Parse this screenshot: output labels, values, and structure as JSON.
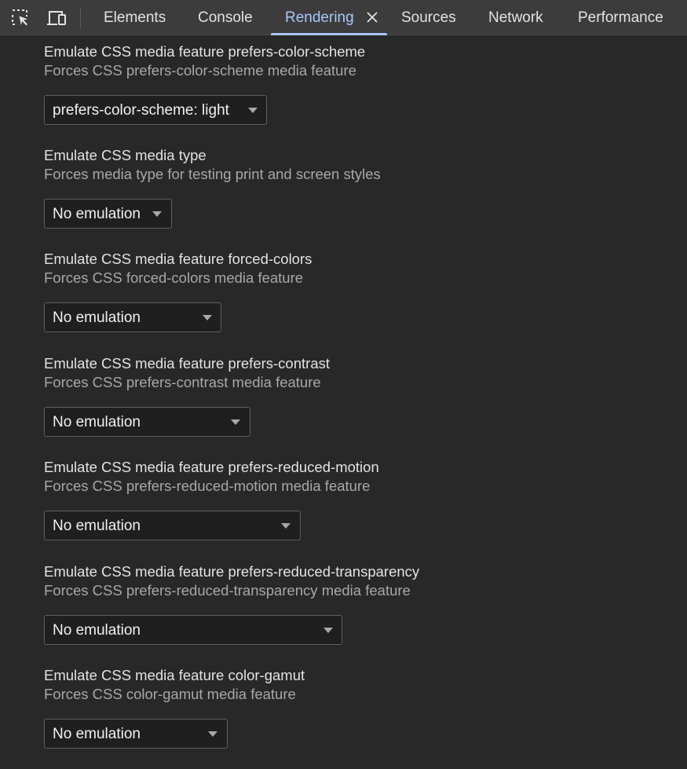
{
  "toolbar": {
    "icons": [
      "inspect-element-icon",
      "device-toolbar-icon"
    ]
  },
  "tabs": [
    {
      "label": "Elements",
      "active": false
    },
    {
      "label": "Console",
      "active": false
    },
    {
      "label": "Rendering",
      "active": true,
      "closable": true
    },
    {
      "label": "Sources",
      "active": false
    },
    {
      "label": "Network",
      "active": false
    },
    {
      "label": "Performance",
      "active": false
    }
  ],
  "colors": {
    "accent": "#a8c7fa",
    "background": "#282828",
    "tabbar": "#3c3c3c"
  },
  "sections": [
    {
      "title": "Emulate CSS media feature prefers-color-scheme",
      "description": "Forces CSS prefers-color-scheme media feature",
      "value": "prefers-color-scheme: light"
    },
    {
      "title": "Emulate CSS media type",
      "description": "Forces media type for testing print and screen styles",
      "value": "No emulation"
    },
    {
      "title": "Emulate CSS media feature forced-colors",
      "description": "Forces CSS forced-colors media feature",
      "value": "No emulation"
    },
    {
      "title": "Emulate CSS media feature prefers-contrast",
      "description": "Forces CSS prefers-contrast media feature",
      "value": "No emulation"
    },
    {
      "title": "Emulate CSS media feature prefers-reduced-motion",
      "description": "Forces CSS prefers-reduced-motion media feature",
      "value": "No emulation"
    },
    {
      "title": "Emulate CSS media feature prefers-reduced-transparency",
      "description": "Forces CSS prefers-reduced-transparency media feature",
      "value": "No emulation"
    },
    {
      "title": "Emulate CSS media feature color-gamut",
      "description": "Forces CSS color-gamut media feature",
      "value": "No emulation"
    }
  ]
}
